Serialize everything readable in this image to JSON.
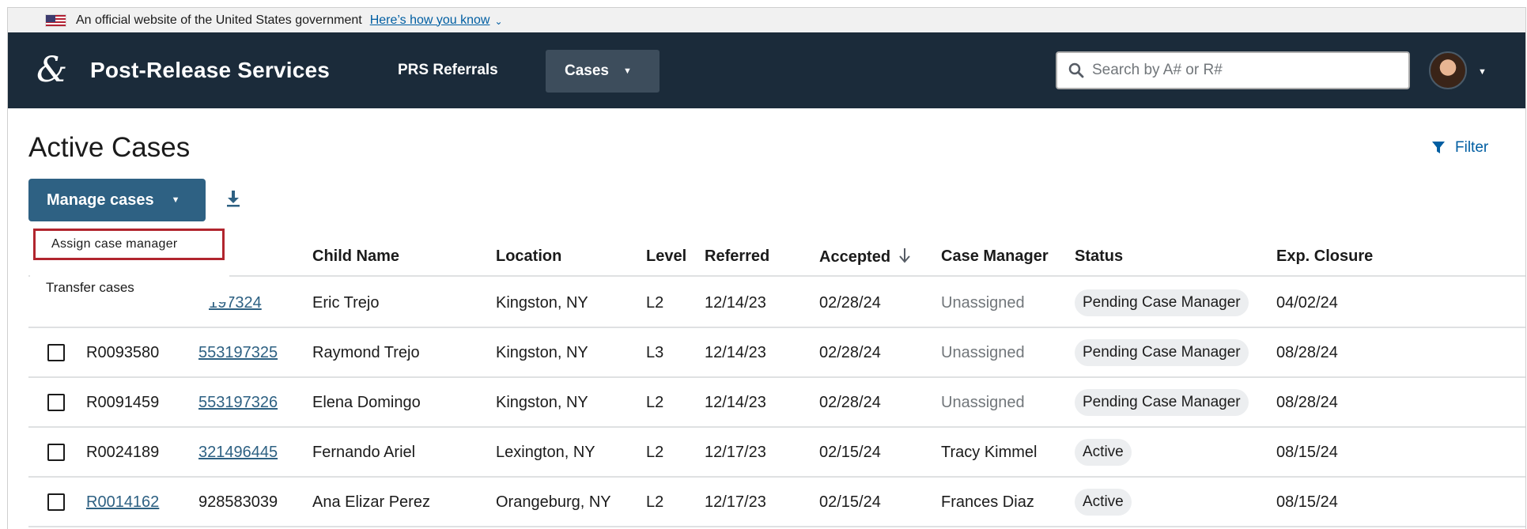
{
  "gov_banner": {
    "text": "An official website of the United States government",
    "link": "Here’s how you know"
  },
  "header": {
    "brand": "Post-Release Services",
    "nav": [
      {
        "label": "PRS Referrals"
      },
      {
        "label": "Cases"
      }
    ],
    "search_placeholder": "Search by A# or R#"
  },
  "main": {
    "title": "Active Cases",
    "filter_label": "Filter",
    "manage_label": "Manage cases",
    "menu": [
      "Assign case manager",
      "Transfer cases"
    ]
  },
  "table": {
    "columns": [
      "",
      "",
      "",
      "Child Name",
      "Location",
      "Level",
      "Referred",
      "Accepted",
      "Case Manager",
      "Status",
      "Exp. Closure"
    ],
    "rows": [
      {
        "r_number": "",
        "a_number": "197324",
        "name": "Eric Trejo",
        "location": "Kingston, NY",
        "level": "L2",
        "referred": "12/14/23",
        "accepted": "02/28/24",
        "manager": "Unassigned",
        "status": "Pending Case Manager",
        "closure": "04/02/24"
      },
      {
        "r_number": "R0093580",
        "a_number": "553197325",
        "name": "Raymond Trejo",
        "location": "Kingston, NY",
        "level": "L3",
        "referred": "12/14/23",
        "accepted": "02/28/24",
        "manager": "Unassigned",
        "status": "Pending Case Manager",
        "closure": "08/28/24"
      },
      {
        "r_number": "R0091459",
        "a_number": "553197326",
        "name": "Elena Domingo",
        "location": "Kingston, NY",
        "level": "L2",
        "referred": "12/14/23",
        "accepted": "02/28/24",
        "manager": "Unassigned",
        "status": "Pending Case Manager",
        "closure": "08/28/24"
      },
      {
        "r_number": "R0024189",
        "a_number": "321496445",
        "name": "Fernando Ariel",
        "location": "Lexington, NY",
        "level": "L2",
        "referred": "12/17/23",
        "accepted": "02/15/24",
        "manager": "Tracy Kimmel",
        "status": "Active",
        "closure": "08/15/24"
      },
      {
        "r_number": "R0014162",
        "a_number": "928583039",
        "name": "Ana Elizar Perez",
        "location": "Orangeburg, NY",
        "level": "L2",
        "referred": "12/17/23",
        "accepted": "02/15/24",
        "manager": "Frances Diaz",
        "status": "Active",
        "closure": "08/15/24"
      }
    ]
  },
  "icons": {
    "flag": "us-flag-icon",
    "logo": "ampersand-logo",
    "search": "search-icon",
    "filter": "filter-icon",
    "download": "download-icon",
    "sort": "arrow-down-icon",
    "caret": "caret-down-icon"
  },
  "colors": {
    "header_bg": "#1b2b3a",
    "accent": "#2e6183",
    "link": "#005ea2",
    "highlight_border": "#b1252e"
  }
}
